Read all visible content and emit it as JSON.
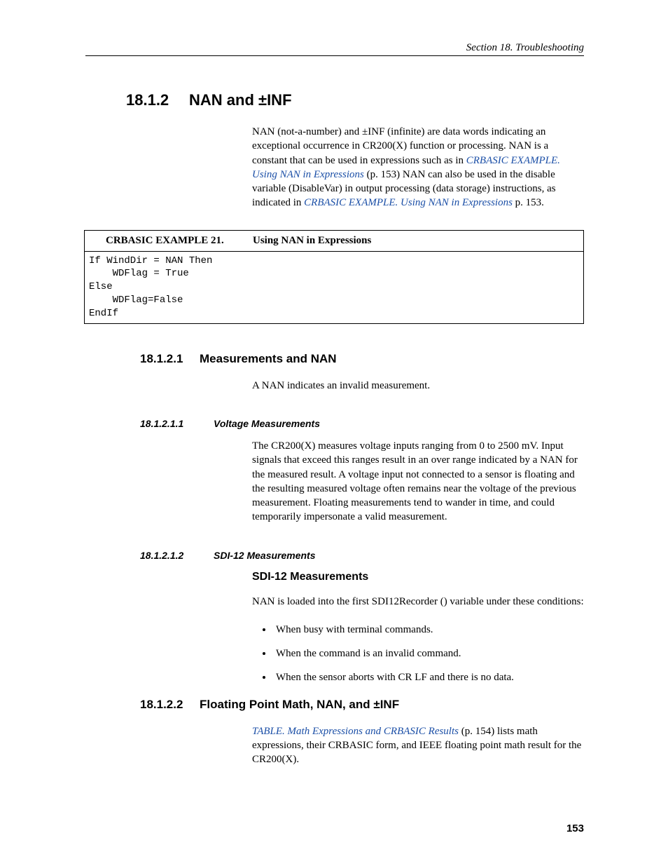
{
  "header": {
    "running": "Section 18.  Troubleshooting"
  },
  "sec": {
    "h2_num": "18.1.2",
    "h2_title": "NAN and ±INF",
    "intro_p1a": "NAN (not-a-number) and ±INF (infinite) are data words indicating an exceptional occurrence in CR200(X) function or processing. NAN is a constant that can be used in expressions such as in ",
    "intro_link1": "CRBASIC EXAMPLE. Using NAN in Expressions",
    "intro_p1b": " (p. 153) NAN can also be used in the disable variable (DisableVar) in output processing (data storage) instructions, as indicated in ",
    "intro_link2": "CRBASIC EXAMPLE. Using NAN in Expressions",
    "intro_p1c": " p. 153.",
    "example_label": "CRBASIC EXAMPLE 21.",
    "example_title": "Using NAN in Expressions",
    "example_code": "If WindDir = NAN Then\n    WDFlag = True\nElse\n    WDFlag=False\nEndIf",
    "h3_num": "18.1.2.1",
    "h3_title": "Measurements and NAN",
    "meas_p": "A NAN indicates an invalid measurement.",
    "h4a_num": "18.1.2.1.1",
    "h4a_title": "Voltage Measurements",
    "voltage_p": "The CR200(X) measures voltage inputs ranging from 0 to 2500 mV.  Input signals that exceed this ranges result in an over range indicated by a NAN for the measured result.  A voltage input not connected to a sensor is floating and the resulting measured voltage often remains near the voltage of the previous measurement. Floating measurements tend to wander in time, and could temporarily impersonate a valid measurement.",
    "h4b_num": "18.1.2.1.2",
    "h4b_title": "SDI-12 Measurements",
    "h5_title": "SDI-12 Measurements",
    "sdi_p": "NAN is loaded into the first SDI12Recorder () variable under these conditions:",
    "bullets": [
      "When busy with terminal commands.",
      "When the command is an invalid command.",
      "When the sensor aborts with CR LF and there is no data."
    ],
    "h3b_num": "18.1.2.2",
    "h3b_title": "Floating Point Math, NAN, and ±INF",
    "float_link": "TABLE. Math Expressions and CRBASIC Results",
    "float_p": " (p. 154) lists math expressions, their CRBASIC form, and IEEE floating point math result for the CR200(X)."
  },
  "page_number": "153"
}
